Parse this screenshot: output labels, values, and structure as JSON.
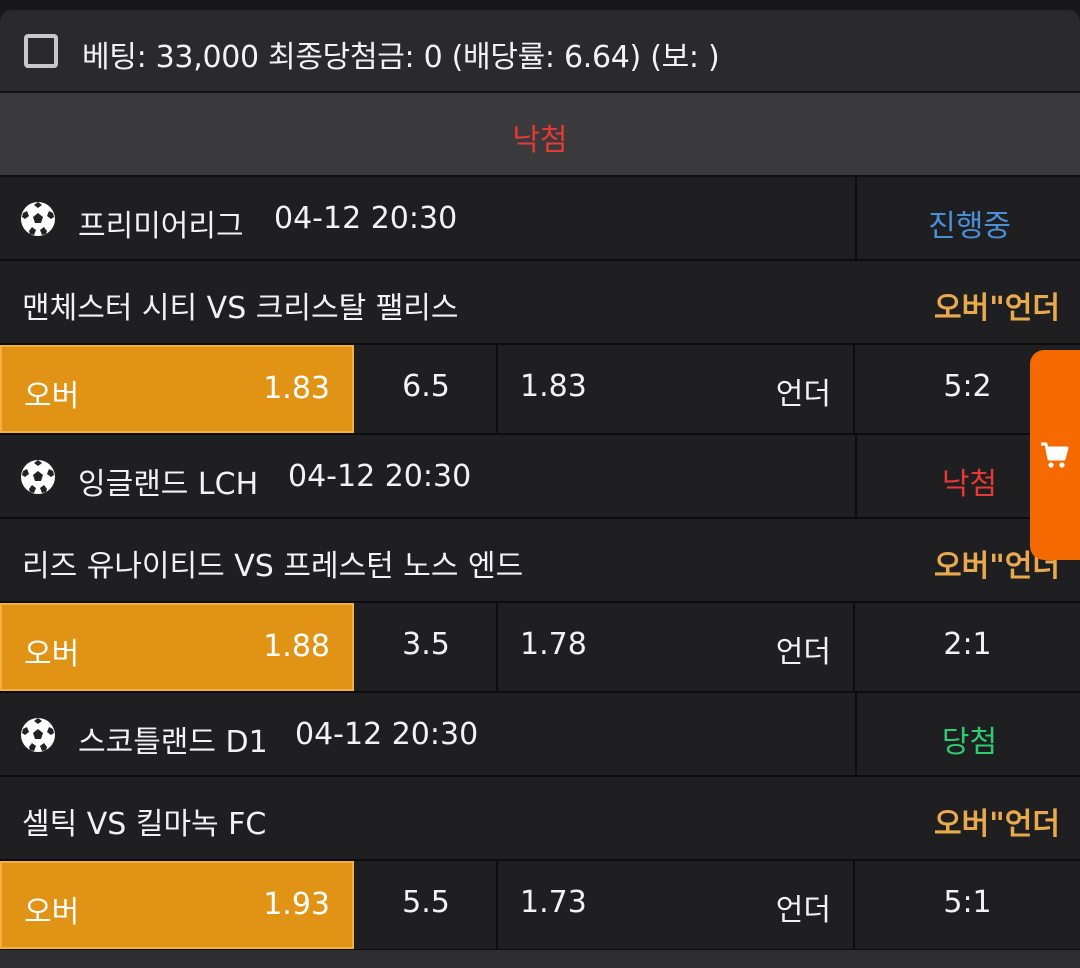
{
  "header": {
    "checkbox_checked": false,
    "summary": "베팅: 33,000 최종당첨금: 0 (배당률: 6.64) (보: )"
  },
  "result": {
    "label": "낙첨",
    "color": "#e53935"
  },
  "matches": [
    {
      "league": "프리미어리그",
      "time": "04-12 20:30",
      "status": "진행중",
      "status_color": "#4a90d9",
      "teams": "맨체스터 시티 VS 크리스탈 팰리스",
      "market": "오버\"언더",
      "over_label": "오버",
      "over_odds": "1.83",
      "line": "6.5",
      "under_odds": "1.83",
      "under_label": "언더",
      "score": "5:2"
    },
    {
      "league": "잉글랜드 LCH",
      "time": "04-12 20:30",
      "status": "낙첨",
      "status_color": "#e53935",
      "teams": "리즈 유나이티드 VS 프레스턴 노스 엔드",
      "market": "오버\"언더",
      "over_label": "오버",
      "over_odds": "1.88",
      "line": "3.5",
      "under_odds": "1.78",
      "under_label": "언더",
      "score": "2:1"
    },
    {
      "league": "스코틀랜드 D1",
      "time": "04-12 20:30",
      "status": "당첨",
      "status_color": "#2ecc71",
      "teams": "셀틱 VS 킬마녹 FC",
      "market": "오버\"언더",
      "over_label": "오버",
      "over_odds": "1.93",
      "line": "5.5",
      "under_odds": "1.73",
      "under_label": "언더",
      "score": "5:1"
    }
  ],
  "icons": {
    "sport": "soccer-ball-icon",
    "cart": "shopping-cart-icon"
  },
  "colors": {
    "over_button": "#e09314",
    "market_label": "#e9a94d",
    "cart_tab": "#f56a00"
  }
}
